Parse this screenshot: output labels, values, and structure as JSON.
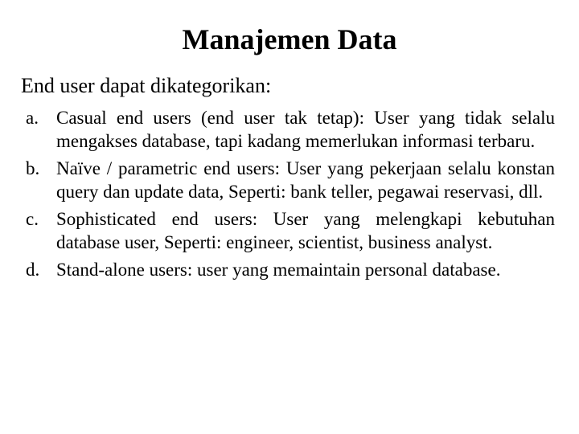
{
  "title": "Manajemen Data",
  "subheading": "End user dapat dikategorikan:",
  "items": [
    {
      "marker": "a.",
      "text": "Casual end users (end user tak tetap): User yang tidak selalu mengakses database, tapi kadang memerlukan informasi terbaru."
    },
    {
      "marker": "b.",
      "text": "Naïve / parametric end users: User yang pekerjaan selalu konstan query dan update data, Seperti: bank teller, pegawai reservasi, dll."
    },
    {
      "marker": "c.",
      "text": "Sophisticated end users: User yang melengkapi kebutuhan database user, Seperti: engineer, scientist, business analyst."
    },
    {
      "marker": "d.",
      "text": "Stand-alone users: user yang memaintain personal database."
    }
  ]
}
